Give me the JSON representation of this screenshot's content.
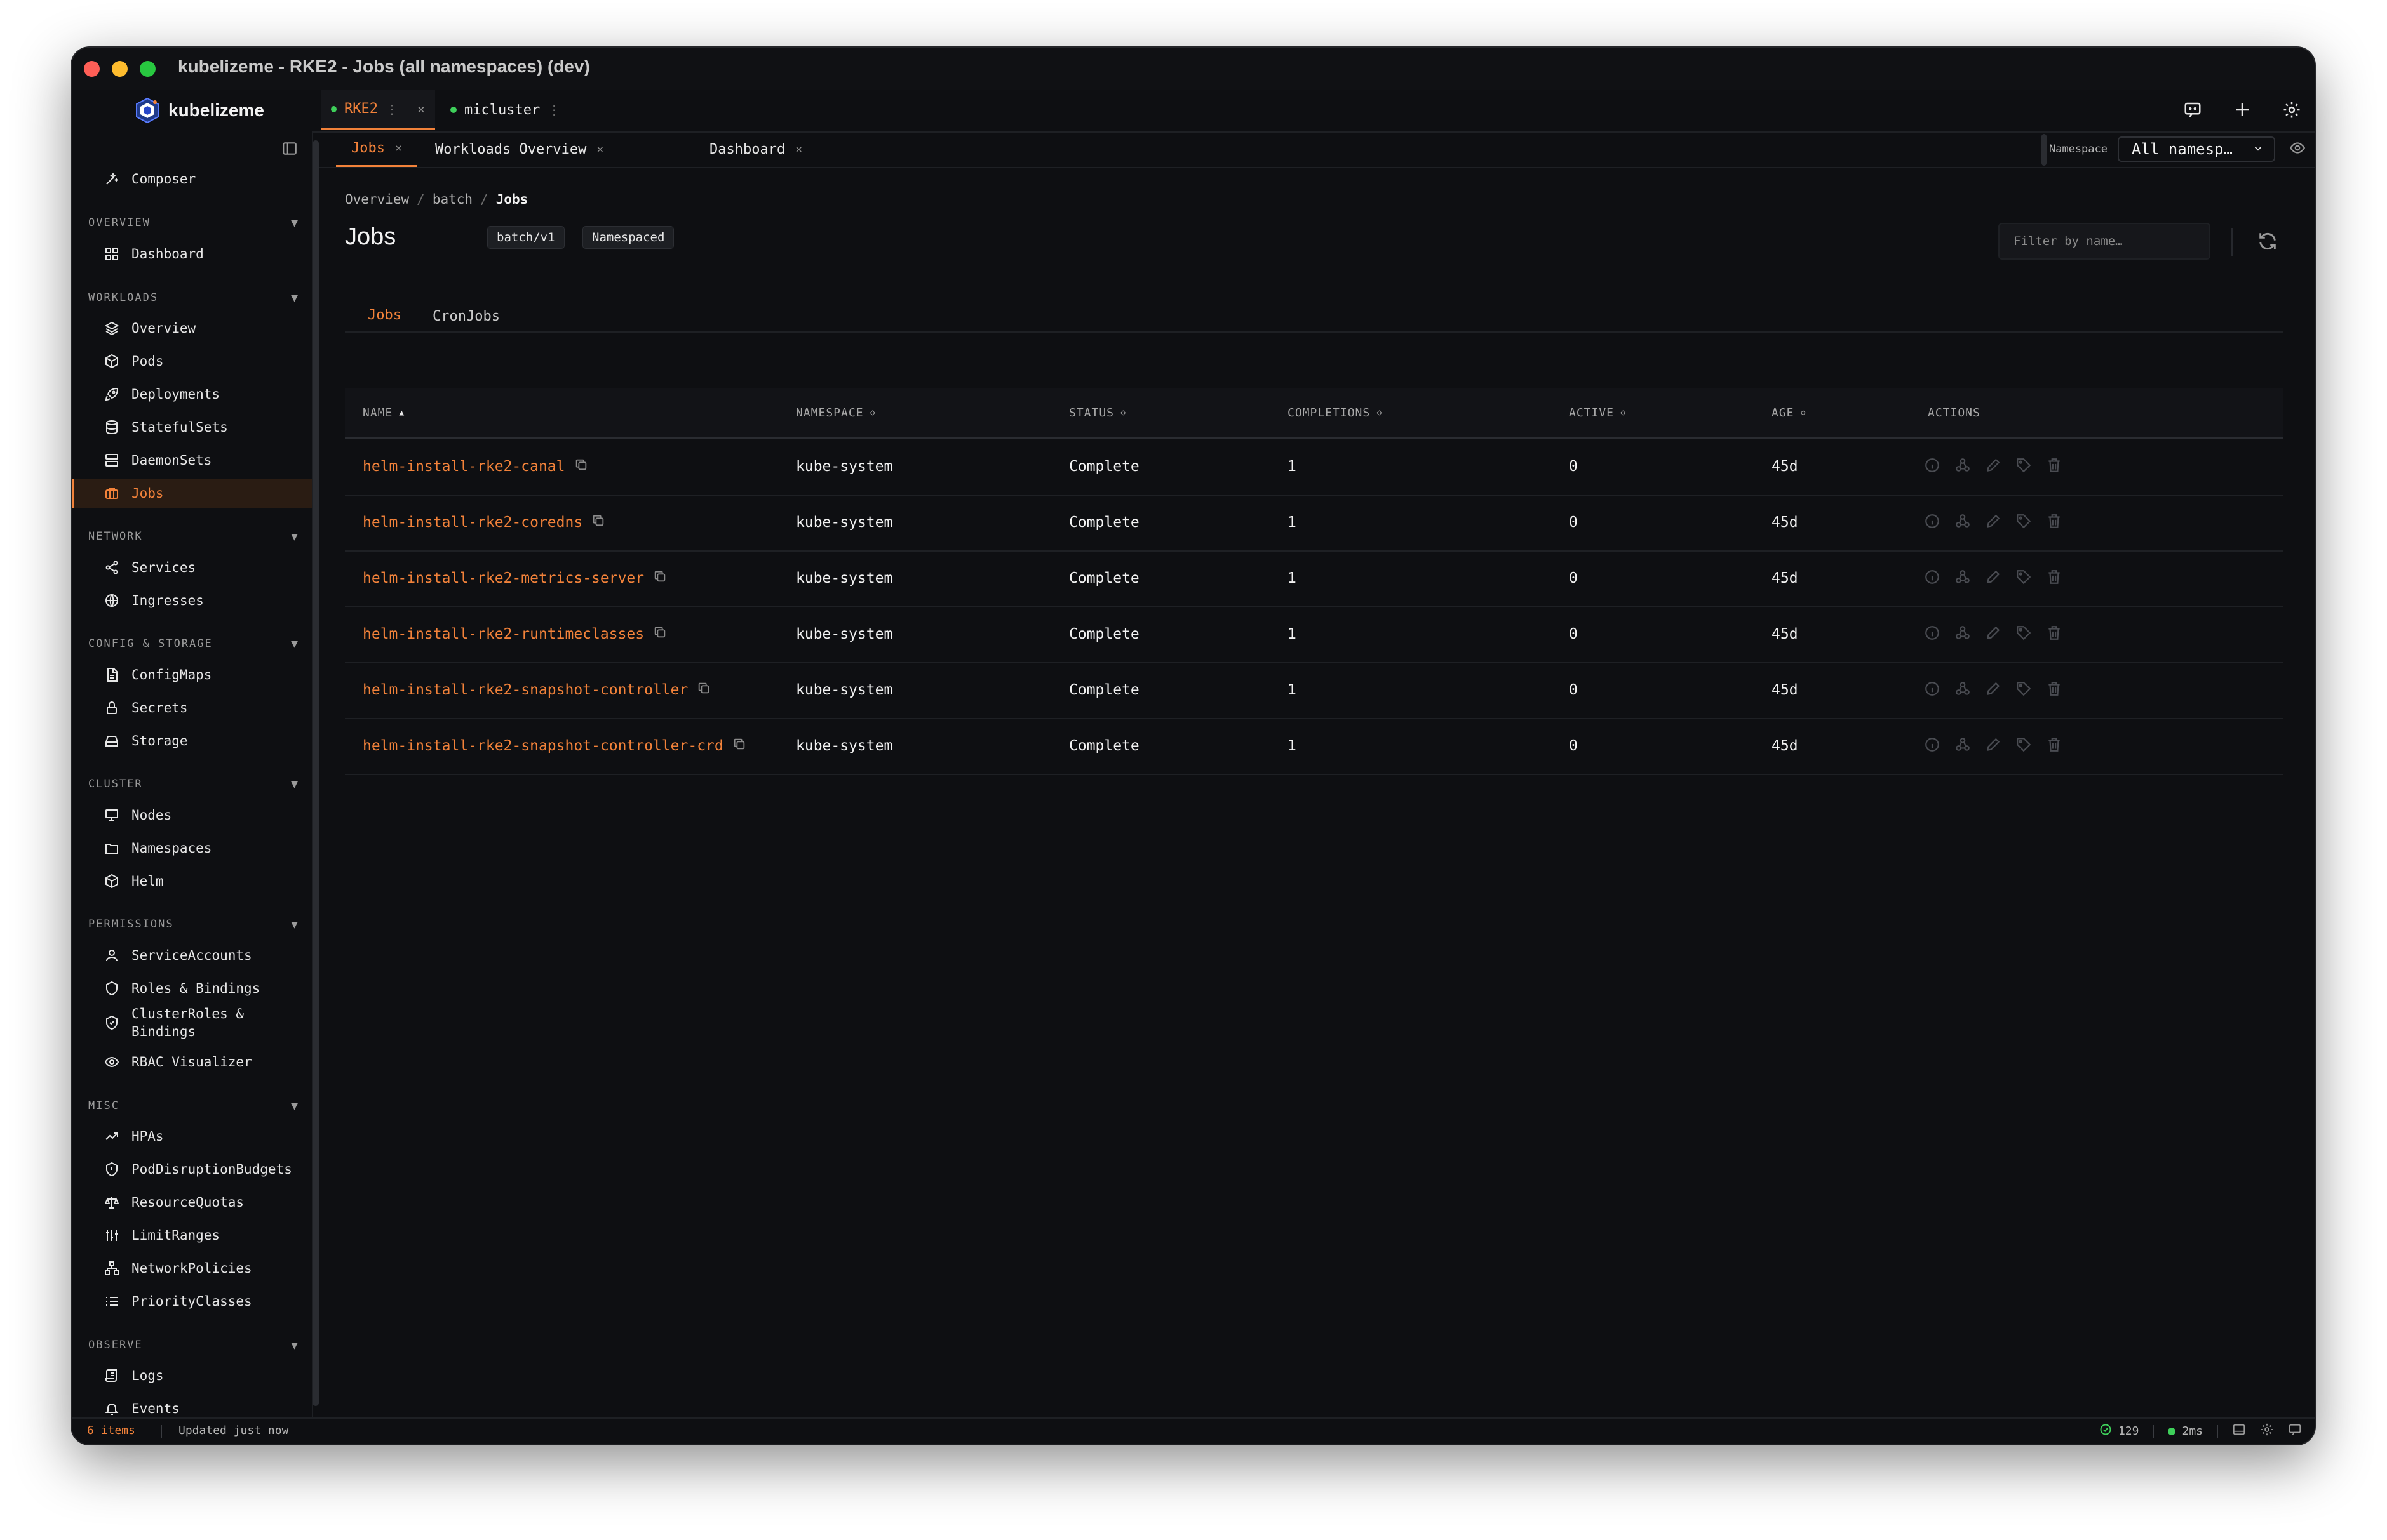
{
  "window": {
    "title": "kubelizeme - RKE2 - Jobs (all namespaces) (dev)"
  },
  "brand": {
    "name": "kubelizeme"
  },
  "clusters": [
    {
      "label": "RKE2",
      "close": "×",
      "more": "⋮"
    },
    {
      "label": "micluster",
      "more": "⋮"
    }
  ],
  "sidebar": {
    "composer": "Composer",
    "sections": {
      "overview": "OVERVIEW",
      "workloads": "WORKLOADS",
      "network": "NETWORK",
      "config": "CONFIG & STORAGE",
      "cluster": "CLUSTER",
      "permissions": "PERMISSIONS",
      "misc": "MISC",
      "observe": "OBSERVE"
    },
    "items": {
      "dashboard": "Dashboard",
      "overview": "Overview",
      "pods": "Pods",
      "deployments": "Deployments",
      "statefulsets": "StatefulSets",
      "daemonsets": "DaemonSets",
      "jobs": "Jobs",
      "services": "Services",
      "ingresses": "Ingresses",
      "configmaps": "ConfigMaps",
      "secrets": "Secrets",
      "storage": "Storage",
      "nodes": "Nodes",
      "namespaces": "Namespaces",
      "helm": "Helm",
      "serviceaccounts": "ServiceAccounts",
      "roles": "Roles & Bindings",
      "clusterroles_1": "ClusterRoles &",
      "clusterroles_2": "Bindings",
      "rbac": "RBAC Visualizer",
      "hpas": "HPAs",
      "pdbs": "PodDisruptionBudgets",
      "quotas": "ResourceQuotas",
      "limitranges": "LimitRanges",
      "netpol": "NetworkPolicies",
      "priority": "PriorityClasses",
      "logs": "Logs",
      "events": "Events"
    }
  },
  "tabs": [
    {
      "label": "Jobs",
      "close": "×"
    },
    {
      "label": "Workloads Overview",
      "close": "×"
    },
    {
      "label": "Dashboard",
      "close": "×"
    }
  ],
  "namespace": {
    "label": "Namespace",
    "value": "All namesp…"
  },
  "breadcrumb": [
    "Overview",
    "batch",
    "Jobs"
  ],
  "breadcrumb_sep": "/",
  "page": {
    "title": "Jobs",
    "badges": [
      "batch/v1",
      "Namespaced"
    ]
  },
  "filter": {
    "placeholder": "Filter by name…"
  },
  "subtabs": [
    "Jobs",
    "CronJobs"
  ],
  "table": {
    "headers": [
      "NAME",
      "NAMESPACE",
      "STATUS",
      "COMPLETIONS",
      "ACTIVE",
      "AGE",
      "ACTIONS"
    ],
    "sort": {
      "name": "▲",
      "other": "◇"
    },
    "rows": [
      {
        "name": "helm-install-rke2-canal",
        "namespace": "kube-system",
        "status": "Complete",
        "completions": "1",
        "active": "0",
        "age": "45d"
      },
      {
        "name": "helm-install-rke2-coredns",
        "namespace": "kube-system",
        "status": "Complete",
        "completions": "1",
        "active": "0",
        "age": "45d"
      },
      {
        "name": "helm-install-rke2-metrics-server",
        "namespace": "kube-system",
        "status": "Complete",
        "completions": "1",
        "active": "0",
        "age": "45d"
      },
      {
        "name": "helm-install-rke2-runtimeclasses",
        "namespace": "kube-system",
        "status": "Complete",
        "completions": "1",
        "active": "0",
        "age": "45d"
      },
      {
        "name": "helm-install-rke2-snapshot-controller",
        "namespace": "kube-system",
        "status": "Complete",
        "completions": "1",
        "active": "0",
        "age": "45d"
      },
      {
        "name": "helm-install-rke2-snapshot-controller-crd",
        "namespace": "kube-system",
        "status": "Complete",
        "completions": "1",
        "active": "0",
        "age": "45d"
      }
    ]
  },
  "status": {
    "items": "6 items",
    "updated": "Updated just now",
    "ok_count": "129",
    "latency": "2ms"
  },
  "colors": {
    "accent": "#f2823a",
    "ok": "#3ecf5a",
    "bg": "#0e0f12"
  },
  "icons": [
    "composer-icon",
    "dashboard-icon",
    "layers-icon",
    "box-icon",
    "rocket-icon",
    "database-icon",
    "server-icon",
    "briefcase-icon",
    "share-icon",
    "globe-icon",
    "file-icon",
    "lock-icon",
    "drive-icon",
    "monitor-icon",
    "folder-icon",
    "user-icon",
    "shield-icon",
    "eye-icon",
    "trend-icon",
    "scale-icon",
    "sliders-icon",
    "network-icon",
    "list-icon",
    "scroll-icon",
    "bell-icon",
    "info-icon",
    "tag-icon",
    "pencil-icon",
    "trash-icon",
    "copy-icon",
    "refresh-icon",
    "gear-icon",
    "plus-icon",
    "chat-icon"
  ]
}
